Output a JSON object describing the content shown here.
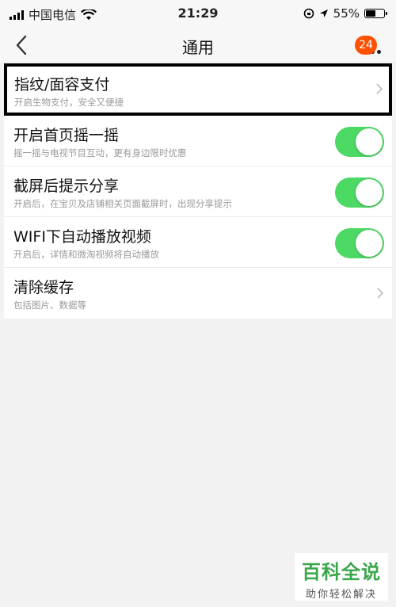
{
  "status_bar": {
    "carrier": "中国电信",
    "time": "21:29",
    "battery": "55%",
    "battery_level": 0.55,
    "icons": [
      "signal-icon",
      "wifi-icon",
      "orientation-lock-icon",
      "location-icon",
      "battery-icon"
    ]
  },
  "nav": {
    "title": "通用",
    "badge": "24",
    "icons": [
      "back-chevron-icon",
      "more-dots-icon"
    ]
  },
  "settings": [
    {
      "title": "指纹/面容支付",
      "subtitle": "开启生物支付，安全又便捷",
      "control": "chevron"
    },
    {
      "title": "开启首页摇一摇",
      "subtitle": "摇一摇与电视节目互动，更有身边限时优惠",
      "control": "toggle",
      "on": true
    },
    {
      "title": "截屏后提示分享",
      "subtitle": "开启后，在宝贝及店铺相关页面截屏时，出现分享提示",
      "control": "toggle",
      "on": true
    },
    {
      "title": "WIFI下自动播放视频",
      "subtitle": "开启后，详情和微淘视频将自动播放",
      "control": "toggle",
      "on": true
    },
    {
      "title": "清除缓存",
      "subtitle": "包括图片、数据等",
      "control": "chevron"
    }
  ],
  "watermark": {
    "main": "百科全说",
    "sub": "助你轻松解决"
  },
  "colors": {
    "toggle_on": "#4cd964",
    "badge": "#ff5000",
    "watermark": "#3aa64a"
  }
}
